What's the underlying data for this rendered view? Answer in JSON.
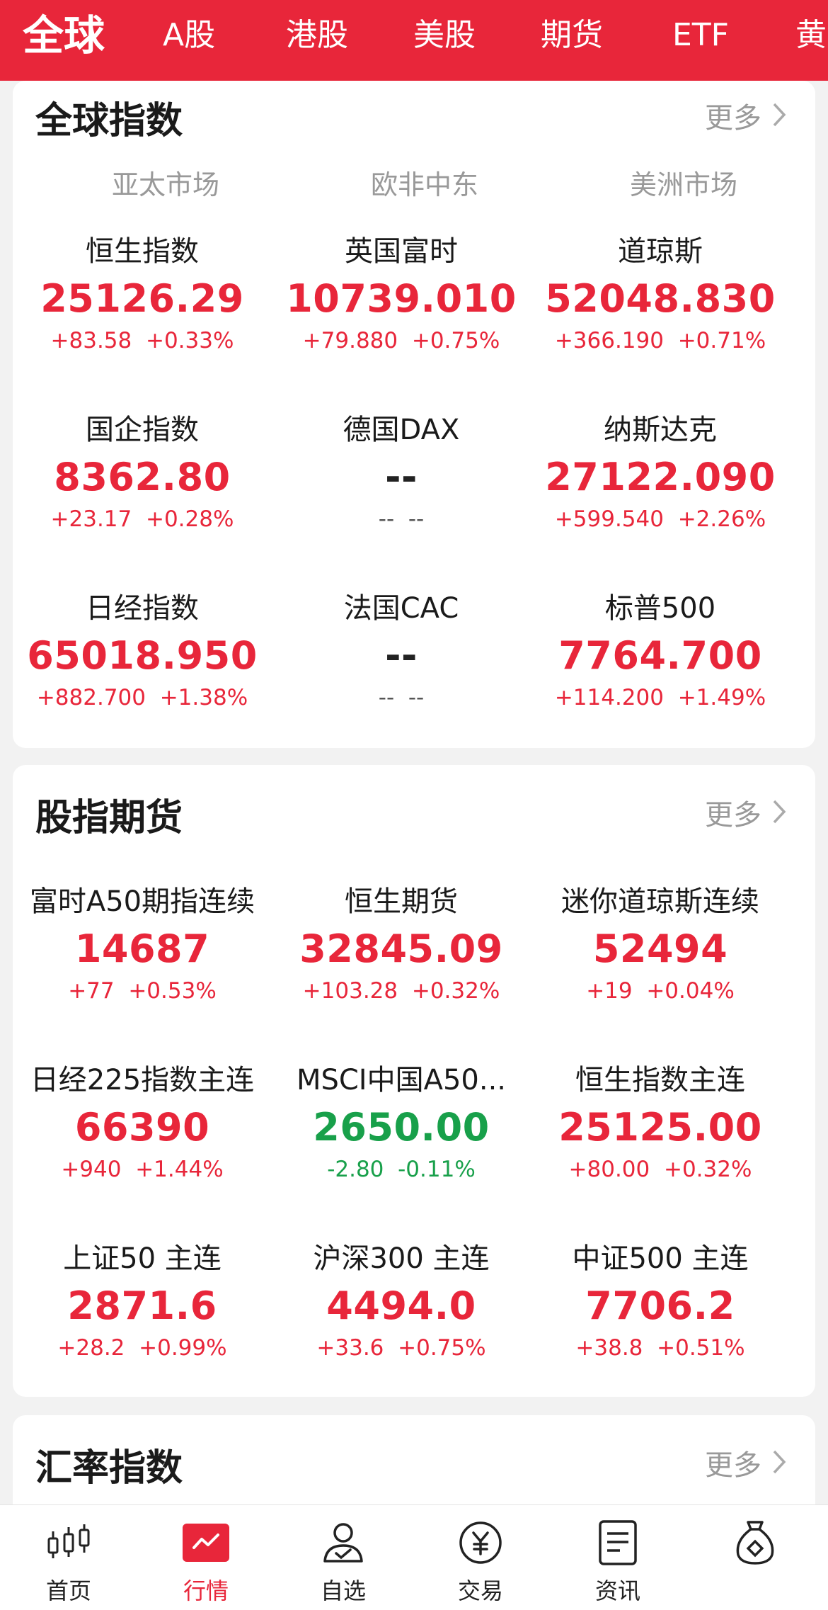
{
  "top_tabs": [
    {
      "label": "全球",
      "active": true
    },
    {
      "label": "A股"
    },
    {
      "label": "港股"
    },
    {
      "label": "美股"
    },
    {
      "label": "期货"
    },
    {
      "label": "ETF"
    },
    {
      "label": "黄"
    }
  ],
  "global_indices": {
    "title": "全球指数",
    "more": "更多",
    "regions": [
      "亚太市场",
      "欧非中东",
      "美洲市场"
    ],
    "items": [
      {
        "name": "恒生指数",
        "value": "25126.29",
        "change": "+83.58",
        "pct": "+0.33%",
        "trend": "up"
      },
      {
        "name": "英国富时",
        "value": "10739.010",
        "change": "+79.880",
        "pct": "+0.75%",
        "trend": "up"
      },
      {
        "name": "道琼斯",
        "value": "52048.830",
        "change": "+366.190",
        "pct": "+0.71%",
        "trend": "up"
      },
      {
        "name": "国企指数",
        "value": "8362.80",
        "change": "+23.17",
        "pct": "+0.28%",
        "trend": "up"
      },
      {
        "name": "德国DAX",
        "value": "--",
        "change": "--",
        "pct": "--",
        "trend": "flat"
      },
      {
        "name": "纳斯达克",
        "value": "27122.090",
        "change": "+599.540",
        "pct": "+2.26%",
        "trend": "up"
      },
      {
        "name": "日经指数",
        "value": "65018.950",
        "change": "+882.700",
        "pct": "+1.38%",
        "trend": "up"
      },
      {
        "name": "法国CAC",
        "value": "--",
        "change": "--",
        "pct": "--",
        "trend": "flat"
      },
      {
        "name": "标普500",
        "value": "7764.700",
        "change": "+114.200",
        "pct": "+1.49%",
        "trend": "up"
      }
    ]
  },
  "index_futures": {
    "title": "股指期货",
    "more": "更多",
    "items": [
      {
        "name": "富时A50期指连续",
        "value": "14687",
        "change": "+77",
        "pct": "+0.53%",
        "trend": "up"
      },
      {
        "name": "恒生期货",
        "value": "32845.09",
        "change": "+103.28",
        "pct": "+0.32%",
        "trend": "up"
      },
      {
        "name": "迷你道琼斯连续",
        "value": "52494",
        "change": "+19",
        "pct": "+0.04%",
        "trend": "up"
      },
      {
        "name": "日经225指数主连",
        "value": "66390",
        "change": "+940",
        "pct": "+1.44%",
        "trend": "up"
      },
      {
        "name": "MSCI中国A50...",
        "value": "2650.00",
        "change": "-2.80",
        "pct": "-0.11%",
        "trend": "down"
      },
      {
        "name": "恒生指数主连",
        "value": "25125.00",
        "change": "+80.00",
        "pct": "+0.32%",
        "trend": "up"
      },
      {
        "name": "上证50 主连",
        "value": "2871.6",
        "change": "+28.2",
        "pct": "+0.99%",
        "trend": "up"
      },
      {
        "name": "沪深300 主连",
        "value": "4494.0",
        "change": "+33.6",
        "pct": "+0.75%",
        "trend": "up"
      },
      {
        "name": "中证500 主连",
        "value": "7706.2",
        "change": "+38.8",
        "pct": "+0.51%",
        "trend": "up"
      }
    ]
  },
  "fx_indices": {
    "title": "汇率指数",
    "more": "更多"
  },
  "bottom_nav": [
    {
      "label": "首页",
      "icon": "candlestick-icon"
    },
    {
      "label": "行情",
      "icon": "market-chart-icon",
      "active": true
    },
    {
      "label": "自选",
      "icon": "user-check-icon"
    },
    {
      "label": "交易",
      "icon": "yen-coin-icon"
    },
    {
      "label": "资讯",
      "icon": "document-icon"
    },
    {
      "label": "",
      "icon": "money-bag-icon"
    }
  ],
  "colors": {
    "up": "#e8263a",
    "down": "#18a04a",
    "brand": "#e8263a"
  }
}
